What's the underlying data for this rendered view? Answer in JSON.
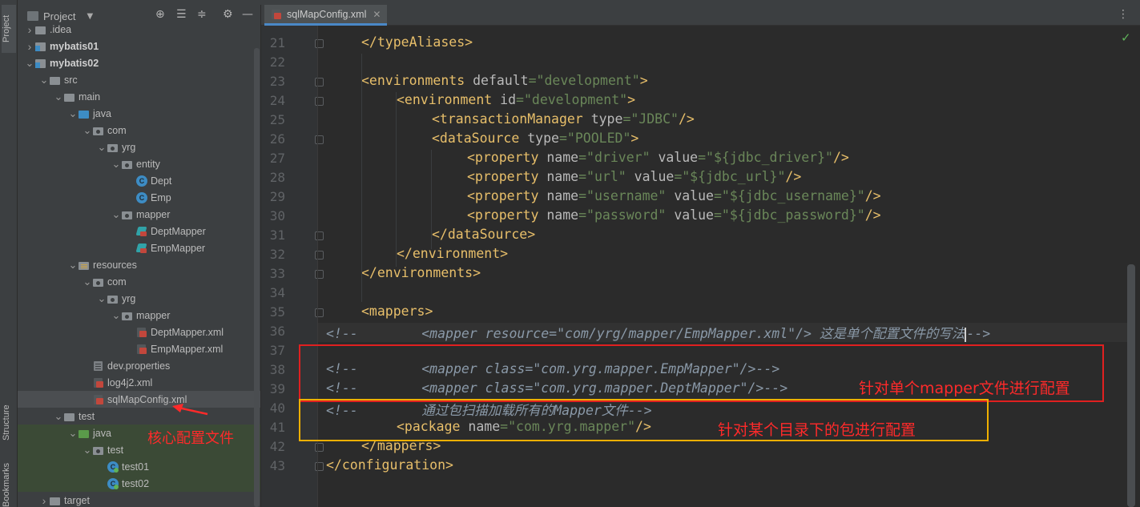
{
  "side_stripe": {
    "project_label": "Project",
    "structure_label": "Structure",
    "bookmarks_label": "Bookmarks"
  },
  "project_panel": {
    "title": "Project",
    "tree": [
      {
        "label": ".idea",
        "icon": "folder",
        "indent": 1,
        "expanded": false,
        "bold": false
      },
      {
        "label": "mybatis01",
        "icon": "module",
        "indent": 1,
        "expanded": false,
        "bold": true
      },
      {
        "label": "mybatis02",
        "icon": "module",
        "indent": 1,
        "expanded": true,
        "bold": true
      },
      {
        "label": "src",
        "icon": "folder",
        "indent": 2,
        "expanded": true,
        "bold": false
      },
      {
        "label": "main",
        "icon": "folder",
        "indent": 3,
        "expanded": true,
        "bold": false
      },
      {
        "label": "java",
        "icon": "folder-blue",
        "indent": 4,
        "expanded": true,
        "bold": false
      },
      {
        "label": "com",
        "icon": "package",
        "indent": 5,
        "expanded": true,
        "bold": false
      },
      {
        "label": "yrg",
        "icon": "package",
        "indent": 6,
        "expanded": true,
        "bold": false
      },
      {
        "label": "entity",
        "icon": "package",
        "indent": 7,
        "expanded": true,
        "bold": false
      },
      {
        "label": "Dept",
        "icon": "class",
        "indent": 8,
        "expanded": null,
        "bold": false
      },
      {
        "label": "Emp",
        "icon": "class",
        "indent": 8,
        "expanded": null,
        "bold": false
      },
      {
        "label": "mapper",
        "icon": "package",
        "indent": 7,
        "expanded": true,
        "bold": false
      },
      {
        "label": "DeptMapper",
        "icon": "mapper",
        "indent": 8,
        "expanded": null,
        "bold": false
      },
      {
        "label": "EmpMapper",
        "icon": "mapper",
        "indent": 8,
        "expanded": null,
        "bold": false
      },
      {
        "label": "resources",
        "icon": "resources",
        "indent": 4,
        "expanded": true,
        "bold": false
      },
      {
        "label": "com",
        "icon": "package",
        "indent": 5,
        "expanded": true,
        "bold": false
      },
      {
        "label": "yrg",
        "icon": "package",
        "indent": 6,
        "expanded": true,
        "bold": false
      },
      {
        "label": "mapper",
        "icon": "package",
        "indent": 7,
        "expanded": true,
        "bold": false
      },
      {
        "label": "DeptMapper.xml",
        "icon": "xml",
        "indent": 8,
        "expanded": null,
        "bold": false
      },
      {
        "label": "EmpMapper.xml",
        "icon": "xml",
        "indent": 8,
        "expanded": null,
        "bold": false
      },
      {
        "label": "dev.properties",
        "icon": "properties",
        "indent": 5,
        "expanded": null,
        "bold": false
      },
      {
        "label": "log4j2.xml",
        "icon": "xml",
        "indent": 5,
        "expanded": null,
        "bold": false
      },
      {
        "label": "sqlMapConfig.xml",
        "icon": "xml",
        "indent": 5,
        "expanded": null,
        "bold": false,
        "selected": true
      },
      {
        "label": "test",
        "icon": "folder",
        "indent": 3,
        "expanded": true,
        "bold": false
      },
      {
        "label": "java",
        "icon": "folder-green",
        "indent": 4,
        "expanded": true,
        "bold": false,
        "test": true
      },
      {
        "label": "test",
        "icon": "package",
        "indent": 5,
        "expanded": true,
        "bold": false,
        "test": true
      },
      {
        "label": "test01",
        "icon": "test-class",
        "indent": 6,
        "expanded": null,
        "bold": false,
        "test": true
      },
      {
        "label": "test02",
        "icon": "test-class",
        "indent": 6,
        "expanded": null,
        "bold": false,
        "test": true
      },
      {
        "label": "target",
        "icon": "folder",
        "indent": 2,
        "expanded": false,
        "bold": false
      }
    ]
  },
  "editor": {
    "tab_label": "sqlMapConfig.xml",
    "lines": [
      {
        "n": "21",
        "html": "<span class=\"t\">&lt;/typeAliases&gt;</span>",
        "indent": 1
      },
      {
        "n": "22",
        "html": "",
        "indent": 0
      },
      {
        "n": "23",
        "html": "<span class=\"t\">&lt;environments </span><span class=\"an\">default</span><span class=\"av\">=\"development\"</span><span class=\"t\">&gt;</span>",
        "indent": 1
      },
      {
        "n": "24",
        "html": "<span class=\"t\">&lt;environment </span><span class=\"an\">id</span><span class=\"av\">=\"development\"</span><span class=\"t\">&gt;</span>",
        "indent": 2
      },
      {
        "n": "25",
        "html": "<span class=\"t\">&lt;transactionManager </span><span class=\"an\">type</span><span class=\"av\">=\"JDBC\"</span><span class=\"t\">/&gt;</span>",
        "indent": 3
      },
      {
        "n": "26",
        "html": "<span class=\"t\">&lt;dataSource </span><span class=\"an\">type</span><span class=\"av\">=\"POOLED\"</span><span class=\"t\">&gt;</span>",
        "indent": 3
      },
      {
        "n": "27",
        "html": "<span class=\"t\">&lt;property </span><span class=\"an\">name</span><span class=\"av\">=\"driver\" </span><span class=\"an\">value</span><span class=\"av\">=\"${jdbc_driver}\"</span><span class=\"t\">/&gt;</span>",
        "indent": 4
      },
      {
        "n": "28",
        "html": "<span class=\"t\">&lt;property </span><span class=\"an\">name</span><span class=\"av\">=\"url\" </span><span class=\"an\">value</span><span class=\"av\">=\"${jdbc_url}\"</span><span class=\"t\">/&gt;</span>",
        "indent": 4
      },
      {
        "n": "29",
        "html": "<span class=\"t\">&lt;property </span><span class=\"an\">name</span><span class=\"av\">=\"username\" </span><span class=\"an\">value</span><span class=\"av\">=\"${jdbc_username}\"</span><span class=\"t\">/&gt;</span>",
        "indent": 4
      },
      {
        "n": "30",
        "html": "<span class=\"t\">&lt;property </span><span class=\"an\">name</span><span class=\"av\">=\"password\" </span><span class=\"an\">value</span><span class=\"av\">=\"${jdbc_password}\"</span><span class=\"t\">/&gt;</span>",
        "indent": 4
      },
      {
        "n": "31",
        "html": "<span class=\"t\">&lt;/dataSource&gt;</span>",
        "indent": 3
      },
      {
        "n": "32",
        "html": "<span class=\"t\">&lt;/environment&gt;</span>",
        "indent": 2
      },
      {
        "n": "33",
        "html": "<span class=\"t\">&lt;/environments&gt;</span>",
        "indent": 1
      },
      {
        "n": "34",
        "html": "",
        "indent": 0
      },
      {
        "n": "35",
        "html": "<span class=\"t\">&lt;mappers&gt;</span>",
        "indent": 1
      },
      {
        "n": "36",
        "html": "<span class=\"cmi\">&lt;!--        &lt;mapper resource=\"com/yrg/mapper/EmpMapper.xml\"/&gt; 这是单个配置文件的写法</span><span class=\"caret\"></span><span class=\"cmi\">--&gt;</span>",
        "indent": 0,
        "current": true
      },
      {
        "n": "37",
        "html": "",
        "indent": 0
      },
      {
        "n": "38",
        "html": "<span class=\"cmi\">&lt;!--        &lt;mapper class=\"com.yrg.mapper.EmpMapper\"/&gt;--&gt;</span>",
        "indent": 0
      },
      {
        "n": "39",
        "html": "<span class=\"cmi\">&lt;!--        &lt;mapper class=\"com.yrg.mapper.DeptMapper\"/&gt;--&gt;</span>",
        "indent": 0
      },
      {
        "n": "40",
        "html": "<span class=\"cmi\">&lt;!--        通过包扫描加载所有的Mapper文件--&gt;</span>",
        "indent": 0
      },
      {
        "n": "41",
        "html": "<span class=\"t\">&lt;package </span><span class=\"an\">name</span><span class=\"av\">=\"com.yrg.mapper\"</span><span class=\"t\">/&gt;</span>",
        "indent": 2
      },
      {
        "n": "42",
        "html": "<span class=\"t\">&lt;/mappers&gt;</span>",
        "indent": 1
      },
      {
        "n": "43",
        "html": "<span class=\"t\">&lt;/configuration&gt;</span>",
        "indent": 0
      }
    ]
  },
  "annotations": {
    "core_config": "核心配置文件",
    "single_mapper": "针对单个mapper文件进行配置",
    "package_config": "针对某个目录下的包进行配置"
  },
  "colors": {
    "annotation_red": "#ff2a2a",
    "box_red": "#e02020",
    "box_orange": "#f0b000",
    "xml_tag": "#e8bf6a",
    "xml_attr_value": "#6a8759"
  }
}
